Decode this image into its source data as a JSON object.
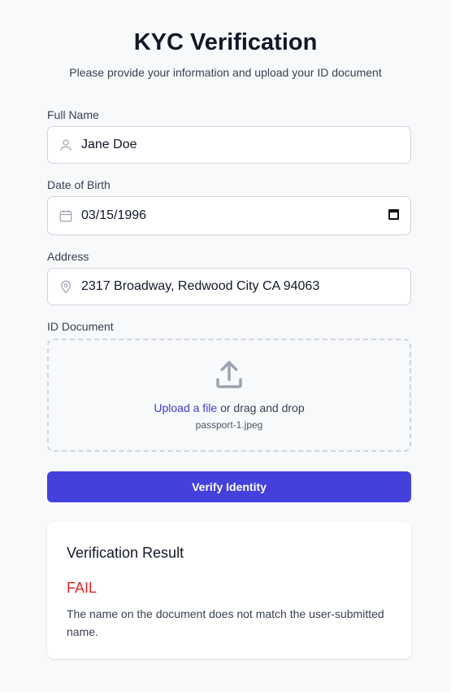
{
  "header": {
    "title": "KYC Verification",
    "subtitle": "Please provide your information and upload your ID document"
  },
  "form": {
    "full_name": {
      "label": "Full Name",
      "value": "Jane Doe",
      "icon": "user-icon"
    },
    "dob": {
      "label": "Date of Birth",
      "value": "03/15/1996",
      "icon": "calendar-icon"
    },
    "address": {
      "label": "Address",
      "value": "2317 Broadway, Redwood City CA 94063",
      "icon": "map-pin-icon"
    },
    "id_document": {
      "label": "ID Document",
      "upload_link": "Upload a file",
      "upload_rest": " or drag and drop",
      "file_name": "passport-1.jpeg"
    },
    "submit_label": "Verify Identity"
  },
  "result": {
    "title": "Verification Result",
    "status": "FAIL",
    "message": "The name on the document does not match the user-submitted name."
  },
  "colors": {
    "accent": "#4340dc",
    "fail": "#dc2626"
  }
}
